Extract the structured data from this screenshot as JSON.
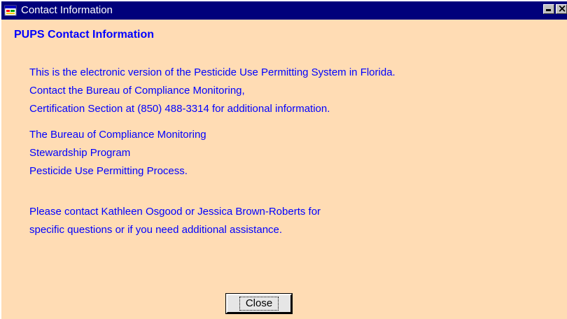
{
  "window": {
    "title": "Contact Information"
  },
  "content": {
    "heading": "PUPS Contact Information",
    "paragraph1": [
      "This is the electronic version of the Pesticide Use Permitting System in Florida.",
      "Contact the Bureau of Compliance Monitoring,",
      "Certification Section at (850) 488-3314 for additional information."
    ],
    "paragraph2": [
      "The Bureau of Compliance Monitoring",
      "Stewardship Program",
      "Pesticide Use Permitting Process."
    ],
    "paragraph3": [
      "Please contact Kathleen Osgood or Jessica Brown-Roberts for",
      "specific questions or if you need additional assistance."
    ]
  },
  "buttons": {
    "close_label": "Close"
  },
  "colors": {
    "titlebar": "#00007b",
    "background": "#ffdcb4",
    "text": "#0000ff"
  },
  "icons": {
    "app": "app-window-icon",
    "minimize": "minimize-icon",
    "close": "close-icon"
  }
}
